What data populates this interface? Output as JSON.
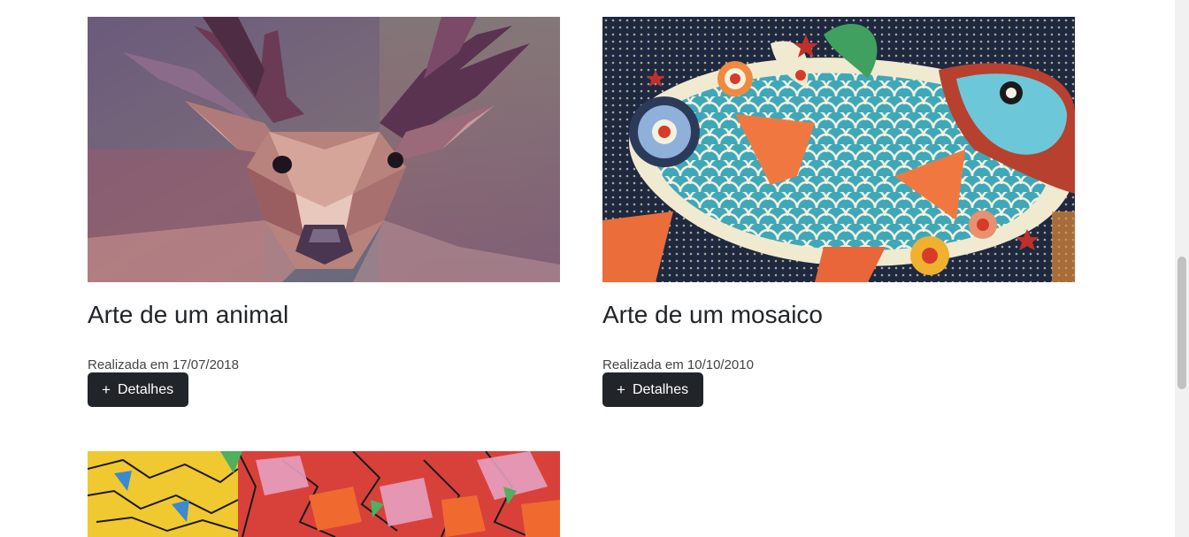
{
  "cards": [
    {
      "title": "Arte de um animal",
      "date": "Realizada em 17/07/2018",
      "button_icon": "+",
      "button_label": "Detalhes",
      "image": "low-poly deer artwork"
    },
    {
      "title": "Arte de um mosaico",
      "date": "Realizada em 10/10/2010",
      "button_icon": "+",
      "button_label": "Detalhes",
      "image": "ceramic fish mosaic artwork"
    },
    {
      "image": "colorful graffiti artwork"
    }
  ],
  "colors": {
    "button_bg": "#212529",
    "title": "#212529",
    "date": "#444444"
  }
}
